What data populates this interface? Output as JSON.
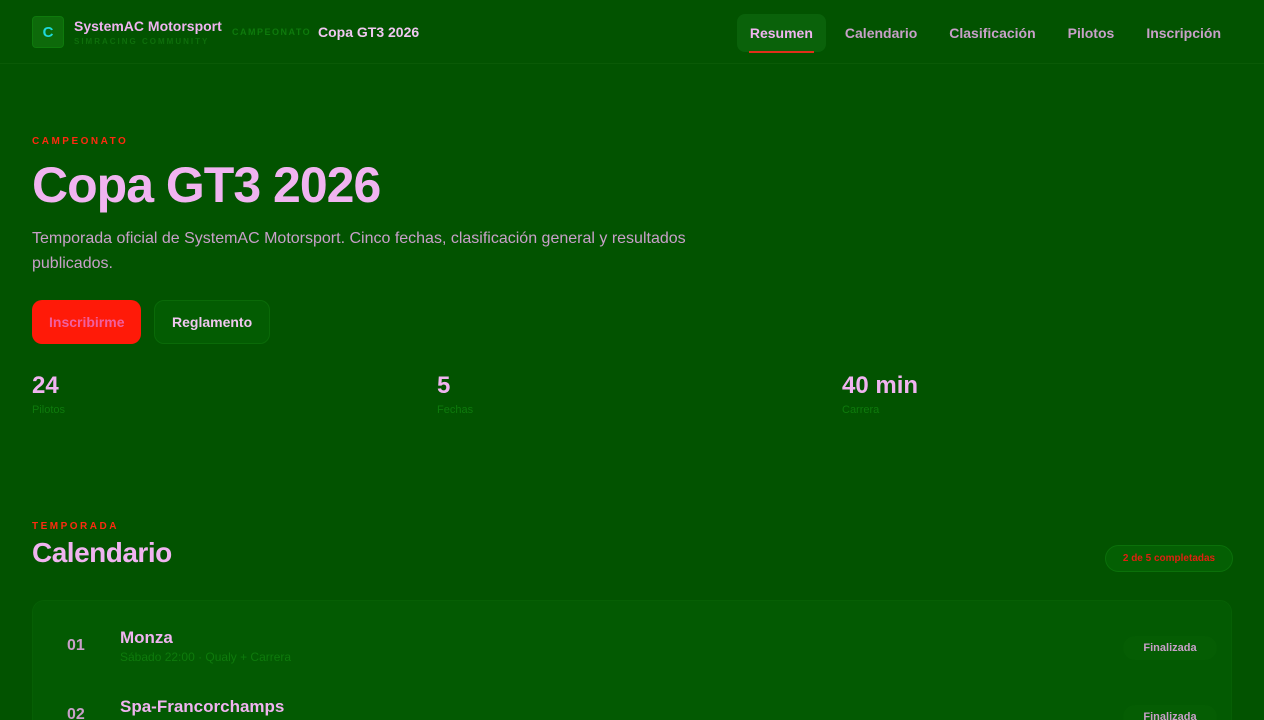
{
  "brand": {
    "logo_letter": "C",
    "name": "SystemAC Motorsport",
    "subtitle": "SIMRACING COMMUNITY"
  },
  "breadcrumb": {
    "label": "CAMPEONATO",
    "title": "Copa GT3 2026"
  },
  "nav": {
    "items": [
      {
        "label": "Resumen",
        "active": true
      },
      {
        "label": "Calendario",
        "active": false
      },
      {
        "label": "Clasificación",
        "active": false
      },
      {
        "label": "Pilotos",
        "active": false
      },
      {
        "label": "Inscripción",
        "active": false
      }
    ]
  },
  "hero": {
    "kicker": "CAMPEONATO",
    "title": "Copa GT3 2026",
    "description": "Temporada oficial de SystemAC Motorsport. Cinco fechas, clasificación general y resultados publicados.",
    "primary_button": "Inscribirme",
    "secondary_button": "Reglamento"
  },
  "stats": [
    {
      "value": "24",
      "label": "Pilotos"
    },
    {
      "value": "5",
      "label": "Fechas"
    },
    {
      "value": "40 min",
      "label": "Carrera"
    }
  ],
  "calendar": {
    "kicker": "TEMPORADA",
    "title": "Calendario",
    "status_pill": "2 de 5 completadas",
    "races": [
      {
        "number": "01",
        "name": "Monza",
        "meta": "Sábado 22:00 · Qualy + Carrera",
        "status": "Finalizada"
      },
      {
        "number": "02",
        "name": "Spa-Francorchamps",
        "meta": "",
        "status": "Finalizada"
      }
    ]
  },
  "colors": {
    "background": "#025300",
    "accent": "#ff1a08",
    "text": "#f0b4f0",
    "muted": "#c8a0c8"
  }
}
